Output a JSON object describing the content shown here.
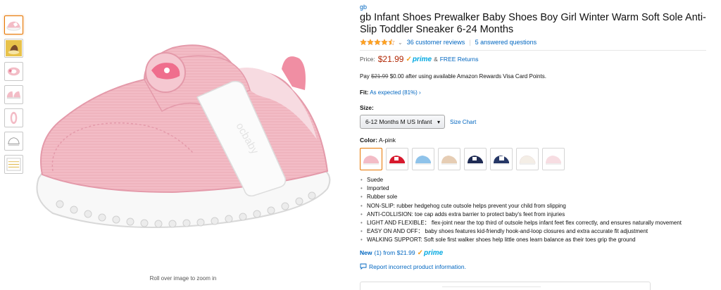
{
  "gallery": {
    "thumbnails": [
      "pink-shoe-side",
      "yellow-shoe-model",
      "shoe-top",
      "pink-shoe-pair",
      "shoe-sole",
      "shoe-outline",
      "size-chart-thumb"
    ],
    "zoom_hint": "Roll over image to zoom in",
    "strap_text": "ocbaby"
  },
  "product": {
    "brand": "gb",
    "title": "gb Infant Shoes Prewalker Baby Shoes Boy Girl Winter Warm Soft Sole Anti-Slip Toddler Sneaker 6-24 Months",
    "rating": 4.5,
    "reviews": "36 customer reviews",
    "questions": "5 answered questions",
    "price_label": "Price:",
    "price": "$21.99",
    "prime": "prime",
    "amp": "&",
    "free_returns": "FREE Returns",
    "rewards": {
      "pay": "Pay",
      "old": "$21.99",
      "rest": "$0.00 after using available Amazon Rewards Visa Card Points."
    },
    "fit": {
      "label": "Fit:",
      "value": "As expected (81%)",
      "arrow": "›"
    },
    "size": {
      "label": "Size:",
      "selected": "6-12 Months M US Infant",
      "chart_link": "Size Chart"
    },
    "color": {
      "label": "Color:",
      "value": "A-pink",
      "swatches": [
        "pink",
        "red",
        "light-blue",
        "beige",
        "navy",
        "navy-white",
        "cream",
        "light-pink"
      ]
    },
    "bullets": [
      "Suede",
      "Imported",
      "Rubber sole",
      "NON-SLIP: rubber hedgehog cute outsole helps prevent your child from slipping",
      "ANTI-COLLISION: toe cap adds extra barrier to protect baby's feet from injuries",
      "LIGHT AND FLEXIBLE： flex-joint near the top third of outsole helps infant feet flex correctly, and ensures naturally movement",
      "EASY ON AND OFF： baby shoes features kid-friendly hook-and-loop closures and extra accurate fit adjustment",
      "WALKING SUPPORT: Soft sole first walker shoes help little ones learn balance as their toes grip the ground"
    ],
    "new_offers": {
      "new": "New",
      "text": "(1) from $21.99"
    },
    "report": "Report incorrect product information."
  },
  "colors": {
    "link": "#0066c0",
    "price": "#b12704",
    "prime": "#00a8e1",
    "star": "#ffa41c",
    "selected_border": "#e77600",
    "shoe_pink": "#f3bcc6"
  }
}
